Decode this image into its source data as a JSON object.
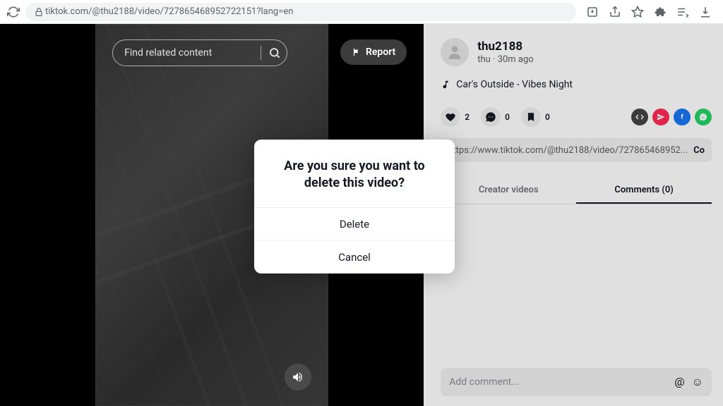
{
  "browser": {
    "url_display": "tiktok.com/@thu2188/video/727865468952722151?lang=en"
  },
  "video": {
    "search_placeholder": "Find related content",
    "report_label": "Report"
  },
  "user": {
    "handle": "thu2188",
    "subline": "thu · 30m ago"
  },
  "music": "Car's Outside - Vibes Night",
  "engage": {
    "likes": "2",
    "comments": "0",
    "saves": "0"
  },
  "share_url": "https://www.tiktok.com/@thu2188/video/727865468952...",
  "copy_label": "Co",
  "tabs": {
    "creator": "Creator videos",
    "comments": "Comments (0)"
  },
  "comment_placeholder": "Add comment...",
  "modal": {
    "title": "Are you sure you want to delete this video?",
    "delete": "Delete",
    "cancel": "Cancel"
  }
}
